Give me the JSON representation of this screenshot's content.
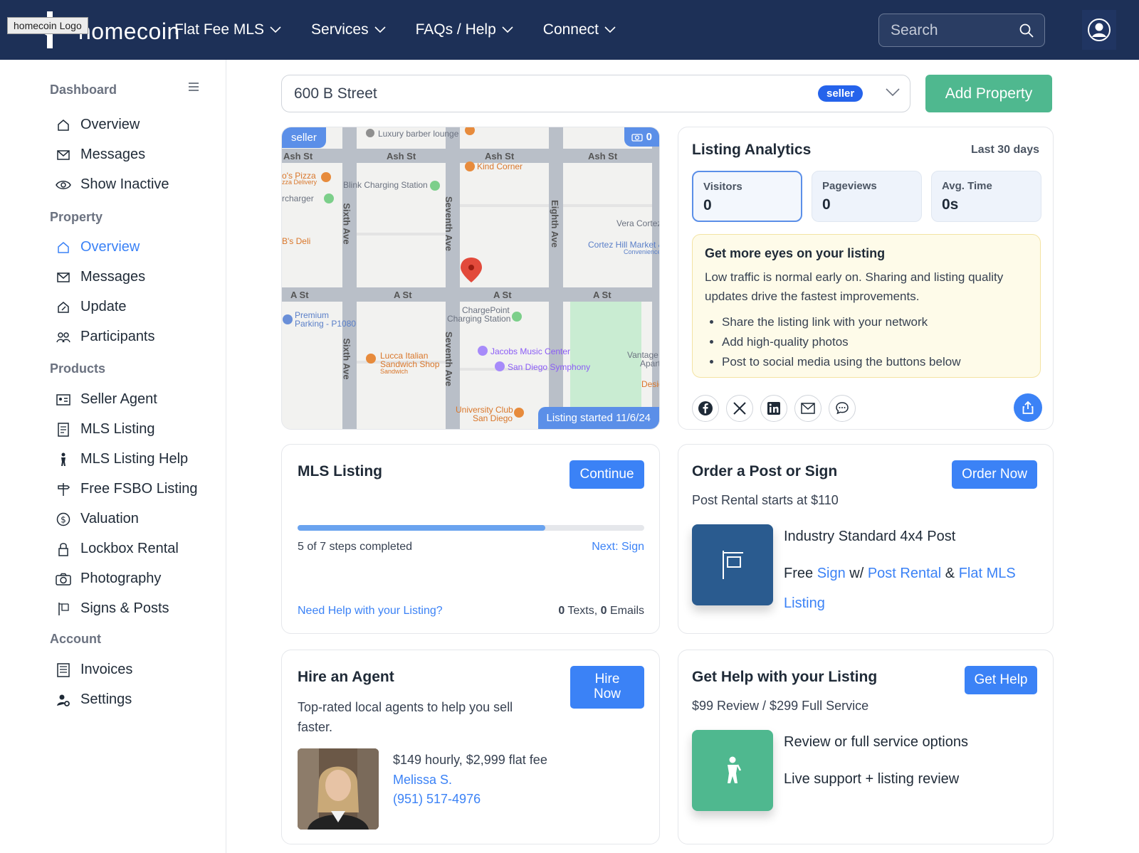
{
  "header": {
    "logo_alt": "homecoin Logo",
    "logo_text": "homecoin",
    "nav": [
      {
        "label": "Flat Fee MLS"
      },
      {
        "label": "Services"
      },
      {
        "label": "FAQs / Help"
      },
      {
        "label": "Connect"
      }
    ],
    "search_placeholder": "Search"
  },
  "sidebar": {
    "dashboard_label": "Dashboard",
    "dashboard_items": [
      "Overview",
      "Messages",
      "Show Inactive"
    ],
    "property_label": "Property",
    "property_items": [
      "Overview",
      "Messages",
      "Update",
      "Participants"
    ],
    "products_label": "Products",
    "products_items": [
      "Seller Agent",
      "MLS Listing",
      "MLS Listing Help",
      "Free FSBO Listing",
      "Valuation",
      "Lockbox Rental",
      "Photography",
      "Signs & Posts"
    ],
    "account_label": "Account",
    "account_items": [
      "Invoices",
      "Settings"
    ]
  },
  "property_select": {
    "address": "600 B Street",
    "role_badge": "seller"
  },
  "add_property_label": "Add Property",
  "map": {
    "role_badge": "seller",
    "photo_count": "0",
    "listing_started": "Listing started 11/6/24",
    "streets": [
      "Ash St",
      "Ash St",
      "Ash St",
      "Ash St",
      "A St",
      "A St",
      "A St",
      "A St",
      "Sixth Ave",
      "Seventh Ave",
      "Eighth Ave",
      "Sixth Ave",
      "Seventh Ave"
    ],
    "places": [
      "Luxury barber lounge",
      "Kind Corner",
      "Blink Charging Station",
      "rcharger",
      "B's Deli",
      "Vera Cortez",
      "Cortez Hill Market &",
      "Convenience",
      "Premium",
      "Parking - P1080",
      "ChargePoint",
      "Charging Station",
      "Lucca Italian",
      "Sandwich Shop",
      "Sandwich",
      "Jacobs Music Center",
      "San Diego Symphony",
      "Vantage I",
      "Apart",
      "Desig",
      "University Club",
      "San Diego",
      "o's Pizza",
      "zza Delivery"
    ]
  },
  "analytics": {
    "title": "Listing Analytics",
    "period": "Last 30 days",
    "stats": [
      {
        "label": "Visitors",
        "value": "0"
      },
      {
        "label": "Pageviews",
        "value": "0"
      },
      {
        "label": "Avg. Time",
        "value": "0s"
      }
    ],
    "tip_title": "Get more eyes on your listing",
    "tip_body": "Low traffic is normal early on. Sharing and listing quality updates drive the fastest improvements.",
    "tip_bullets": [
      "Share the listing link with your network",
      "Add high-quality photos",
      "Post to social media using the buttons below"
    ],
    "social": [
      "facebook-icon",
      "x-icon",
      "linkedin-icon",
      "email-icon",
      "chat-icon",
      "share-icon"
    ]
  },
  "mls_card": {
    "title": "MLS Listing",
    "button": "Continue",
    "progress_text": "5 of 7 steps completed",
    "progress_fraction": 0.714,
    "next_label": "Next: Sign",
    "help_link": "Need Help with your Listing?",
    "texts_count": "0",
    "texts_label": "Texts,",
    "emails_count": "0",
    "emails_label": "Emails"
  },
  "sign_card": {
    "title": "Order a Post or Sign",
    "button": "Order Now",
    "subtitle": "Post Rental starts at $110",
    "item_title": "Industry Standard 4x4 Post",
    "free_text": "Free",
    "sign_link": "Sign",
    "w_text": "w/",
    "post_link": "Post Rental",
    "amp": "&",
    "flat_link": "Flat MLS",
    "listing_link": "Listing"
  },
  "agent_card": {
    "title": "Hire an Agent",
    "button_line1": "Hire",
    "button_line2": "Now",
    "subtitle": "Top-rated local agents to help you sell faster.",
    "price": "$149 hourly, $2,999 flat fee",
    "agent_name": "Melissa S.",
    "agent_phone": "(951) 517-4976"
  },
  "help_card": {
    "title": "Get Help with your Listing",
    "button": "Get Help",
    "subtitle": "$99 Review / $299 Full Service",
    "line1": "Review or full service options",
    "line2": "Live support + listing review"
  },
  "colors": {
    "nav_bg": "#1d3057",
    "accent_blue": "#3b82f6",
    "green": "#4fb88f",
    "sign_tile": "#2a5b8f"
  }
}
